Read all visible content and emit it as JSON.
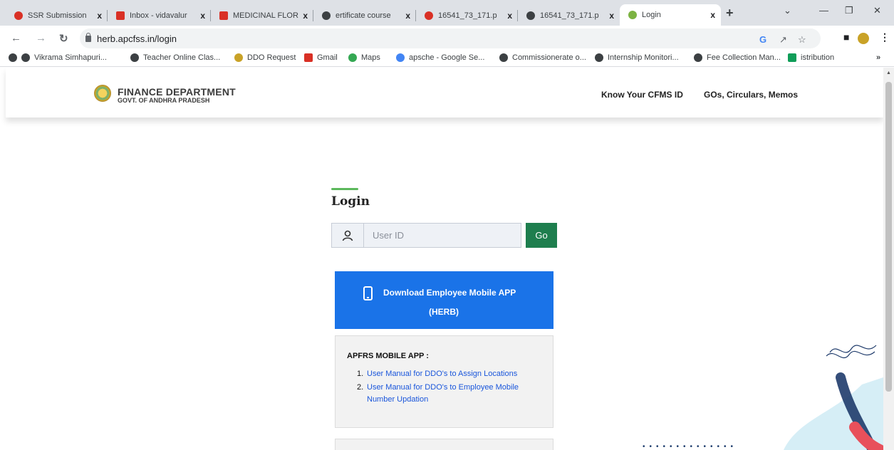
{
  "browser": {
    "tabs": [
      {
        "label": "SSR Submission",
        "color": "#d93025"
      },
      {
        "label": "Inbox - vidavalur",
        "color": "#d93025"
      },
      {
        "label": "MEDICINAL FLOR",
        "color": "#d93025"
      },
      {
        "label": "ertificate course",
        "color": "#3c4043"
      },
      {
        "label": "16541_73_171.p",
        "color": "#d93025"
      },
      {
        "label": "16541_73_171.p",
        "color": "#3c4043"
      },
      {
        "label": "Login",
        "color": "#7cb342"
      }
    ],
    "close_glyph": "x",
    "new_tab_glyph": "+",
    "url": "herb.apcfss.in/login",
    "bookmarks": [
      {
        "label": "Vikrama Simhapuri..."
      },
      {
        "label": "Teacher Online Clas..."
      },
      {
        "label": "DDO Request"
      },
      {
        "label": "Gmail"
      },
      {
        "label": "Maps"
      },
      {
        "label": "apsche - Google Se..."
      },
      {
        "label": "Commissionerate o..."
      },
      {
        "label": "Internship Monitori..."
      },
      {
        "label": "Fee Collection Man..."
      },
      {
        "label": "istribution"
      }
    ],
    "bookmarks_overflow": "»"
  },
  "site": {
    "logo_title": "FINANCE DEPARTMENT",
    "logo_subtitle": "GOVT. OF ANDHRA PRADESH",
    "nav": [
      "Know Your CFMS ID",
      "GOs, Circulars, Memos"
    ]
  },
  "login": {
    "title": "Login",
    "user_placeholder": "User ID",
    "go_label": "Go"
  },
  "download": {
    "line1": "Download Employee Mobile APP",
    "line2": "(HERB)"
  },
  "apfrs": {
    "title": "APFRS MOBILE APP :",
    "items": [
      {
        "num": "1.",
        "label": "User Manual for DDO's to Assign Locations"
      },
      {
        "num": "2.",
        "label": "User Manual for DDO's to Employee Mobile Number Updation"
      }
    ]
  },
  "colors": {
    "accent_green": "#1e7e4e",
    "download_blue": "#1a73e8"
  }
}
